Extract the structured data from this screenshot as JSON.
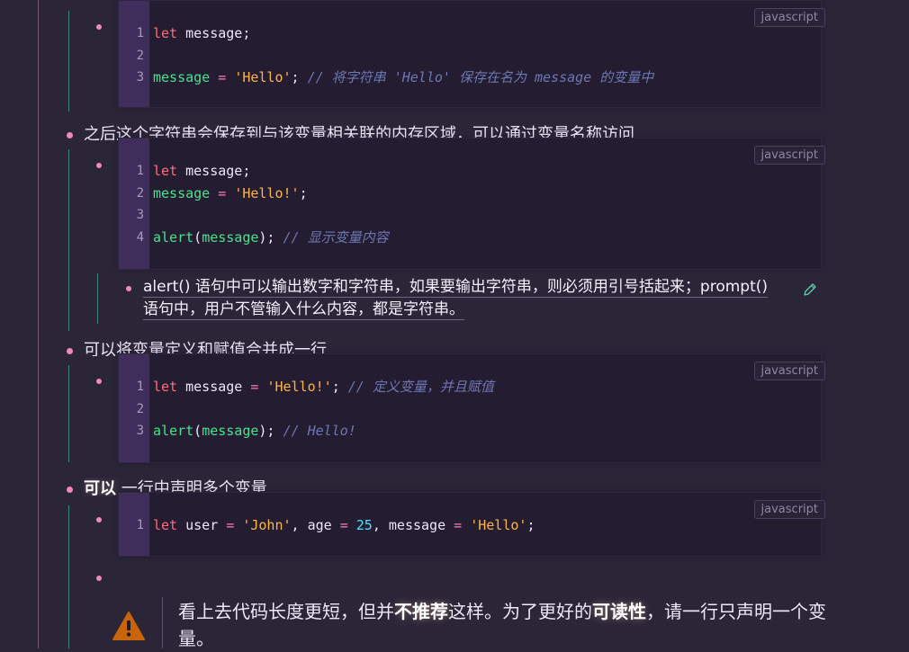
{
  "paragraphs": {
    "p1": "之后这个字符串会保存到与该变量相关联的内存区域，可以通过变量名称访问",
    "p2": "可以将变量定义和赋值合并成一行",
    "p3_bold": "可以",
    "p3_rest": "一行中声明多个变量"
  },
  "code_blocks": [
    {
      "lang": "javascript",
      "lines": [
        {
          "n": "1",
          "tokens": [
            [
              "kw",
              "let"
            ],
            [
              "plain",
              " message;"
            ]
          ]
        },
        {
          "n": "2",
          "tokens": []
        },
        {
          "n": "3",
          "tokens": [
            [
              "fn",
              "message"
            ],
            [
              "plain",
              " "
            ],
            [
              "op",
              "="
            ],
            [
              "plain",
              " "
            ],
            [
              "str",
              "'Hello'"
            ],
            [
              "plain",
              "; "
            ],
            [
              "com",
              "// 将字符串 'Hello' 保存在名为 message 的变量中"
            ]
          ]
        }
      ]
    },
    {
      "lang": "javascript",
      "lines": [
        {
          "n": "1",
          "tokens": [
            [
              "kw",
              "let"
            ],
            [
              "plain",
              " message;"
            ]
          ]
        },
        {
          "n": "2",
          "tokens": [
            [
              "fn",
              "message"
            ],
            [
              "plain",
              " "
            ],
            [
              "op",
              "="
            ],
            [
              "plain",
              " "
            ],
            [
              "str",
              "'Hello!'"
            ],
            [
              "plain",
              ";"
            ]
          ]
        },
        {
          "n": "3",
          "tokens": []
        },
        {
          "n": "4",
          "tokens": [
            [
              "fn",
              "alert"
            ],
            [
              "plain",
              "("
            ],
            [
              "fn",
              "message"
            ],
            [
              "plain",
              "); "
            ],
            [
              "com",
              "// 显示变量内容"
            ]
          ]
        }
      ]
    },
    {
      "lang": "javascript",
      "lines": [
        {
          "n": "1",
          "tokens": [
            [
              "kw",
              "let"
            ],
            [
              "plain",
              " message "
            ],
            [
              "op",
              "="
            ],
            [
              "plain",
              " "
            ],
            [
              "str",
              "'Hello!'"
            ],
            [
              "plain",
              "; "
            ],
            [
              "com",
              "// 定义变量，并且赋值"
            ]
          ]
        },
        {
          "n": "2",
          "tokens": []
        },
        {
          "n": "3",
          "tokens": [
            [
              "fn",
              "alert"
            ],
            [
              "plain",
              "("
            ],
            [
              "fn",
              "message"
            ],
            [
              "plain",
              "); "
            ],
            [
              "com",
              "// Hello!"
            ]
          ]
        }
      ]
    },
    {
      "lang": "javascript",
      "lines": [
        {
          "n": "1",
          "tokens": [
            [
              "kw",
              "let"
            ],
            [
              "plain",
              " user "
            ],
            [
              "op",
              "="
            ],
            [
              "plain",
              " "
            ],
            [
              "str",
              "'John'"
            ],
            [
              "plain",
              ", age "
            ],
            [
              "op",
              "="
            ],
            [
              "plain",
              " "
            ],
            [
              "num",
              "25"
            ],
            [
              "plain",
              ", message "
            ],
            [
              "op",
              "="
            ],
            [
              "plain",
              " "
            ],
            [
              "str",
              "'Hello'"
            ],
            [
              "plain",
              ";"
            ]
          ]
        }
      ]
    }
  ],
  "note": {
    "line1": "alert() 语句中可以输出数字和字符串，如果要输出字符串，则必须用引号括起来；prompt()",
    "line2": "语句中，用户不管输入什么内容，都是字符串。"
  },
  "warning": {
    "t1": "看上去代码长度更短，但并",
    "b1": "不推荐",
    "t2": "这样。为了更好的",
    "b2": "可读性",
    "t3": "，请一行只声明一个变",
    "t4": "量。"
  },
  "icons": {
    "edit": "pencil-edit-icon",
    "warning": "warning-triangle-icon"
  },
  "colors": {
    "bullet": "#f08ab8",
    "keyword": "#ff6b7a",
    "string": "#ffb545",
    "function": "#47e38c",
    "number": "#4fe0ff",
    "comment": "#6e77b3",
    "warning": "#c8650a"
  }
}
